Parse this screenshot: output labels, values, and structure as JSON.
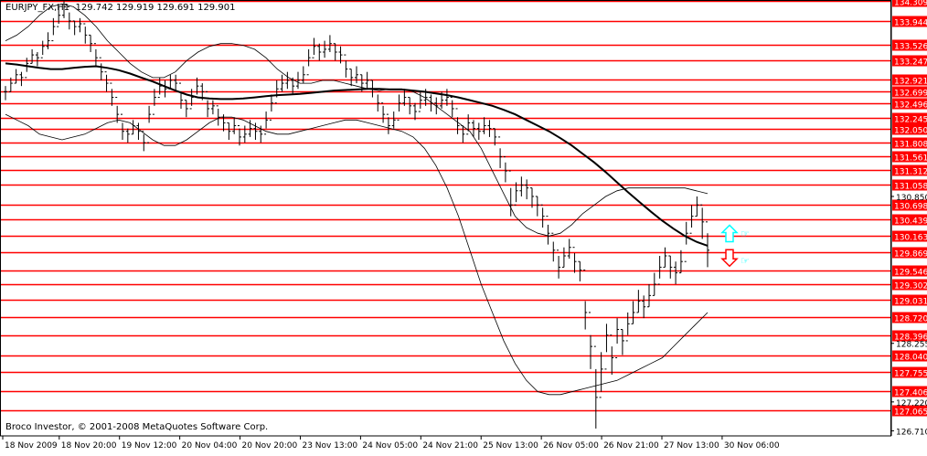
{
  "header": {
    "symbol": "EURJPY_FX,H1",
    "ohlc": "129.742 129.919 129.691 129.901"
  },
  "footer": {
    "copyright": "Broco Investor, © 2001-2008 MetaQuotes Software Corp."
  },
  "colors": {
    "level_line": "#ff0000",
    "level_label_bg": "#ff0000",
    "level_label_text": "#ffffff",
    "price_bars": "#000000",
    "moving_average": "#000000",
    "bands": "#000000",
    "buy_arrow": "#00ffff",
    "sell_arrow": "#ff0000"
  },
  "chart_data": {
    "type": "candlestick",
    "ylim": [
      126.62,
      134.32
    ],
    "grid": false,
    "price_levels": [
      134.309,
      133.944,
      133.526,
      133.247,
      132.921,
      132.699,
      132.496,
      132.245,
      132.05,
      131.808,
      131.561,
      131.312,
      131.058,
      130.698,
      130.439,
      130.163,
      129.869,
      129.546,
      129.302,
      129.031,
      128.72,
      128.396,
      128.04,
      127.755,
      127.406,
      127.065
    ],
    "y_tick_labels": [
      "130.850",
      "128.255",
      "127.220",
      "126.710"
    ],
    "y_tick_values": [
      130.85,
      128.255,
      127.22,
      126.71
    ],
    "x_labels": [
      "18 Nov 2009",
      "18 Nov 20:00",
      "19 Nov 12:00",
      "20 Nov 04:00",
      "20 Nov 20:00",
      "23 Nov 13:00",
      "24 Nov 05:00",
      "24 Nov 21:00",
      "25 Nov 13:00",
      "26 Nov 05:00",
      "26 Nov 21:00",
      "27 Nov 13:00",
      "30 Nov 06:00"
    ],
    "x_label_bar_index": [
      0,
      15,
      31,
      47,
      63,
      79,
      95,
      111,
      127,
      143,
      159,
      175,
      191
    ],
    "close": [
      132.7,
      132.85,
      133.0,
      132.95,
      133.2,
      133.35,
      133.3,
      133.5,
      133.6,
      133.85,
      134.05,
      134.2,
      133.95,
      133.85,
      133.9,
      133.7,
      133.55,
      133.3,
      133.05,
      132.85,
      132.6,
      132.3,
      132.0,
      131.95,
      132.1,
      132.0,
      131.8,
      132.3,
      132.6,
      132.8,
      132.75,
      132.9,
      132.85,
      132.55,
      132.4,
      132.6,
      132.8,
      132.7,
      132.4,
      132.45,
      132.25,
      132.15,
      132.0,
      132.1,
      131.9,
      131.95,
      132.05,
      132.0,
      131.95,
      132.2,
      132.5,
      132.75,
      132.85,
      132.9,
      132.8,
      132.9,
      133.0,
      133.3,
      133.5,
      133.4,
      133.45,
      133.55,
      133.4,
      133.35,
      133.1,
      132.95,
      133.0,
      132.85,
      132.9,
      132.75,
      132.5,
      132.3,
      132.1,
      132.2,
      132.5,
      132.6,
      132.45,
      132.35,
      132.55,
      132.6,
      132.5,
      132.45,
      132.55,
      132.6,
      132.4,
      132.1,
      131.95,
      132.15,
      132.05,
      132.0,
      132.1,
      132.05,
      131.9,
      131.55,
      131.3,
      130.7,
      130.95,
      131.05,
      131.0,
      130.85,
      130.7,
      130.5,
      130.2,
      129.9,
      129.6,
      129.8,
      129.95,
      129.7,
      129.55,
      128.8,
      128.2,
      127.3,
      127.8,
      128.4,
      128.0,
      128.5,
      128.3,
      128.6,
      128.8,
      129.0,
      128.9,
      129.1,
      129.3,
      129.6,
      129.8,
      129.6,
      129.5,
      129.7,
      130.2,
      130.5,
      130.7,
      130.4,
      129.9
    ],
    "high": [
      132.8,
      132.95,
      133.1,
      133.05,
      133.3,
      133.45,
      133.4,
      133.6,
      133.75,
      134.0,
      134.2,
      134.3,
      134.1,
      133.95,
      134.0,
      133.85,
      133.7,
      133.45,
      133.2,
      133.0,
      132.75,
      132.45,
      132.15,
      132.05,
      132.2,
      132.15,
      131.95,
      132.45,
      132.75,
      132.95,
      132.9,
      133.0,
      133.0,
      132.7,
      132.55,
      132.75,
      132.95,
      132.85,
      132.55,
      132.55,
      132.4,
      132.3,
      132.15,
      132.25,
      132.05,
      132.1,
      132.2,
      132.15,
      132.1,
      132.35,
      132.65,
      132.9,
      133.0,
      133.05,
      132.95,
      133.05,
      133.15,
      133.45,
      133.65,
      133.55,
      133.6,
      133.7,
      133.55,
      133.5,
      133.25,
      133.1,
      133.15,
      133.0,
      133.05,
      132.9,
      132.65,
      132.45,
      132.25,
      132.35,
      132.65,
      132.75,
      132.6,
      132.5,
      132.7,
      132.75,
      132.65,
      132.6,
      132.7,
      132.75,
      132.55,
      132.25,
      132.1,
      132.3,
      132.2,
      132.15,
      132.25,
      132.2,
      132.05,
      131.7,
      131.45,
      131.0,
      131.1,
      131.2,
      131.15,
      131.0,
      130.85,
      130.65,
      130.35,
      130.05,
      129.8,
      129.95,
      130.1,
      129.85,
      129.7,
      129.0,
      128.4,
      127.8,
      128.1,
      128.6,
      128.2,
      128.7,
      128.5,
      128.8,
      129.0,
      129.2,
      129.1,
      129.3,
      129.5,
      129.8,
      129.95,
      129.8,
      129.7,
      129.9,
      130.4,
      130.7,
      130.85,
      130.65,
      130.2
    ],
    "low": [
      132.55,
      132.7,
      132.85,
      132.8,
      133.05,
      133.2,
      133.15,
      133.35,
      133.45,
      133.7,
      133.9,
      134.0,
      133.8,
      133.7,
      133.75,
      133.55,
      133.4,
      133.15,
      132.9,
      132.7,
      132.45,
      132.15,
      131.85,
      131.8,
      131.95,
      131.85,
      131.65,
      132.15,
      132.45,
      132.65,
      132.6,
      132.75,
      132.7,
      132.4,
      132.25,
      132.45,
      132.65,
      132.55,
      132.25,
      132.3,
      132.1,
      132.0,
      131.85,
      131.95,
      131.75,
      131.8,
      131.9,
      131.85,
      131.8,
      132.05,
      132.35,
      132.6,
      132.7,
      132.75,
      132.65,
      132.75,
      132.85,
      133.15,
      133.35,
      133.25,
      133.3,
      133.4,
      133.25,
      133.2,
      132.95,
      132.8,
      132.85,
      132.7,
      132.75,
      132.6,
      132.35,
      132.15,
      131.95,
      132.05,
      132.35,
      132.45,
      132.3,
      132.2,
      132.4,
      132.45,
      132.35,
      132.3,
      132.4,
      132.45,
      132.25,
      131.95,
      131.8,
      132.0,
      131.9,
      131.85,
      131.95,
      131.9,
      131.75,
      131.35,
      131.1,
      130.5,
      130.75,
      130.85,
      130.8,
      130.65,
      130.5,
      130.3,
      130.0,
      129.7,
      129.4,
      129.6,
      129.75,
      129.5,
      129.35,
      128.5,
      127.8,
      126.75,
      127.4,
      128.1,
      127.7,
      128.25,
      128.05,
      128.4,
      128.6,
      128.8,
      128.7,
      128.9,
      129.1,
      129.4,
      129.6,
      129.4,
      129.3,
      129.5,
      130.0,
      130.3,
      130.5,
      130.1,
      129.6
    ],
    "moving_average": [
      133.2,
      133.18,
      133.15,
      133.12,
      133.1,
      133.1,
      133.12,
      133.14,
      133.15,
      133.12,
      133.08,
      133.02,
      132.95,
      132.88,
      132.8,
      132.72,
      132.65,
      132.6,
      132.58,
      132.57,
      132.57,
      132.58,
      132.6,
      132.62,
      132.64,
      132.65,
      132.66,
      132.68,
      132.7,
      132.72,
      132.73,
      132.74,
      132.75,
      132.75,
      132.74,
      132.74,
      132.72,
      132.7,
      132.67,
      132.64,
      132.6,
      132.55,
      132.5,
      132.45,
      132.38,
      132.3,
      132.2,
      132.1,
      132.0,
      131.88,
      131.75,
      131.6,
      131.45,
      131.28,
      131.1,
      130.92,
      130.75,
      130.58,
      130.42,
      130.28,
      130.15,
      130.05,
      129.98
    ],
    "upper_band": [
      133.6,
      133.7,
      133.85,
      134.05,
      134.2,
      134.25,
      134.2,
      134.05,
      133.85,
      133.6,
      133.4,
      133.2,
      133.05,
      132.95,
      132.95,
      133.05,
      133.25,
      133.4,
      133.5,
      133.55,
      133.55,
      133.52,
      133.45,
      133.3,
      133.1,
      132.95,
      132.85,
      132.85,
      132.9,
      132.9,
      132.85,
      132.8,
      132.75,
      132.72,
      132.75,
      132.75,
      132.7,
      132.6,
      132.45,
      132.3,
      132.15,
      132.0,
      131.7,
      131.3,
      130.9,
      130.5,
      130.3,
      130.2,
      130.15,
      130.2,
      130.35,
      130.55,
      130.7,
      130.85,
      130.95,
      131.0,
      131.0,
      131.0,
      131.0,
      131.0,
      131.0,
      130.95,
      130.9
    ],
    "lower_band": [
      132.3,
      132.2,
      132.1,
      131.95,
      131.9,
      131.85,
      131.9,
      131.95,
      132.05,
      132.15,
      132.2,
      132.15,
      132.0,
      131.85,
      131.75,
      131.75,
      131.85,
      132.0,
      132.15,
      132.25,
      132.25,
      132.2,
      132.1,
      132.0,
      131.95,
      131.95,
      132.0,
      132.05,
      132.1,
      132.15,
      132.2,
      132.2,
      132.15,
      132.1,
      132.05,
      132.0,
      131.9,
      131.7,
      131.4,
      131.0,
      130.5,
      129.9,
      129.3,
      128.8,
      128.3,
      127.9,
      127.6,
      127.4,
      127.35,
      127.35,
      127.4,
      127.45,
      127.5,
      127.55,
      127.6,
      127.7,
      127.8,
      127.9,
      128.0,
      128.2,
      128.4,
      128.6,
      128.8
    ],
    "signals": [
      {
        "bar": 132,
        "direction": "up",
        "price": 130.18
      },
      {
        "bar": 132,
        "direction": "down",
        "price": 129.78
      }
    ]
  }
}
